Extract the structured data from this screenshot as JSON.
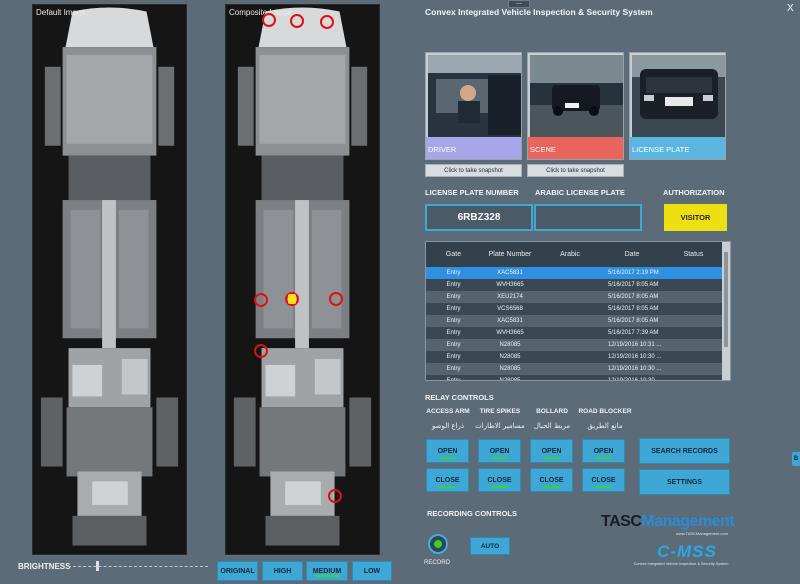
{
  "app": {
    "title": "Convex Integrated Vehicle Inspection & Security System",
    "close": "X",
    "topbar": "---"
  },
  "images": {
    "default_title": "Default Image",
    "composite_title": "Composite Image"
  },
  "brightness": {
    "label": "BRIGHTNESS",
    "value_fraction": 0.2
  },
  "modes": [
    {
      "label": "ORIGINAL",
      "active": false
    },
    {
      "label": "HIGH",
      "active": false
    },
    {
      "label": "MEDIUM",
      "active": true
    },
    {
      "label": "LOW",
      "active": false
    }
  ],
  "snapshots": [
    {
      "caption": "DRIVER",
      "button": "Click to take snapshot",
      "color": "#a7a6e9"
    },
    {
      "caption": "SCENE",
      "button": "Click to take snapshot",
      "color": "#e9645c"
    },
    {
      "caption": "LICENSE PLATE",
      "button": "",
      "color": "#5ab6e0"
    }
  ],
  "plate": {
    "number_label": "LICENSE PLATE NUMBER",
    "number_value": "6RBZ328",
    "arabic_label": "ARABIC LICENSE PLATE",
    "arabic_value": ""
  },
  "authorization": {
    "label": "AUTHORIZATION",
    "value": "VISITOR",
    "color": "#ecdf12"
  },
  "table": {
    "headers": [
      "Gate",
      "Plate Number",
      "Arabic",
      "Date",
      "Status"
    ],
    "rows": [
      [
        "Entry",
        "XAC5831",
        "",
        "5/16/2017 2:19 PM",
        ""
      ],
      [
        "Entry",
        "WVH3665",
        "",
        "5/16/2017 8:05 AM",
        ""
      ],
      [
        "Entry",
        "XEU2174",
        "",
        "5/16/2017 8:05 AM",
        ""
      ],
      [
        "Entry",
        "VCS6568",
        "",
        "5/16/2017 8:05 AM",
        ""
      ],
      [
        "Entry",
        "XAC5831",
        "",
        "5/16/2017 8:05 AM",
        ""
      ],
      [
        "Entry",
        "WVH3665",
        "",
        "5/16/2017 7:39 AM",
        ""
      ],
      [
        "Entry",
        "N28085",
        "",
        "12/19/2016 10:31 ...",
        ""
      ],
      [
        "Entry",
        "N28085",
        "",
        "12/19/2016 10:30 ...",
        ""
      ],
      [
        "Entry",
        "N28085",
        "",
        "12/19/2016 10:30 ...",
        ""
      ],
      [
        "Entry",
        "N28085",
        "",
        "12/19/2016 10:30 ...",
        ""
      ]
    ],
    "selected_row": 0
  },
  "relay": {
    "title": "RELAY CONTROLS",
    "items": [
      {
        "name": "ACCESS ARM",
        "arabic": "ذراع الوصو",
        "open": "OPEN",
        "close": "CLOSE"
      },
      {
        "name": "TIRE SPIKES",
        "arabic": "مسامير الاطارات",
        "open": "OPEN",
        "close": "CLOSE"
      },
      {
        "name": "BOLLARD",
        "arabic": "مربط الحبال",
        "open": "OPEN",
        "close": "CLOSE"
      },
      {
        "name": "ROAD BLOCKER",
        "arabic": "مانع الطريق",
        "open": "OPEN",
        "close": "CLOSE"
      }
    ],
    "search_records": "SEARCH RECORDS",
    "settings": "SETTINGS"
  },
  "recording": {
    "title": "RECORDING CONTROLS",
    "record_label": "RECORD",
    "auto_label": "AUTO"
  },
  "branding": {
    "tasc_part1": "TASC",
    "tasc_part2": "Management",
    "tasc_url": "www.TASCManagement.com",
    "cmss": "C-MSS",
    "cmss_sub": "Convex Integrated Vehicle Inspection & Security System"
  },
  "side_tab": "B"
}
